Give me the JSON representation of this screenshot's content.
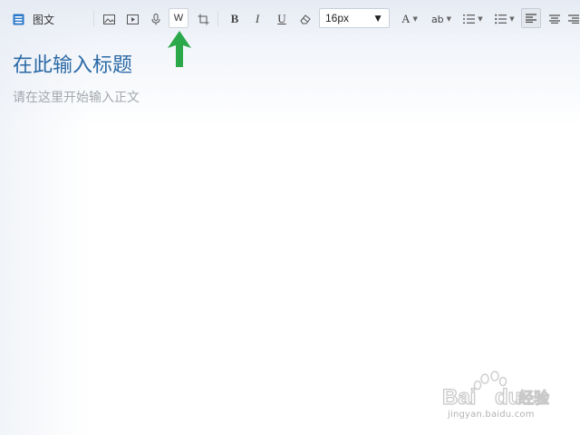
{
  "toolbar": {
    "brand_label": "图文",
    "word_label": "W",
    "bold_label": "B",
    "italic_label": "I",
    "underline_label": "U",
    "font_size": "16px",
    "font_color_label": "A",
    "highlight_label": "ab",
    "icons": [
      "article-icon",
      "image-icon",
      "video-icon",
      "microphone-icon",
      "crop-icon",
      "eraser-icon",
      "line-spacing-icon",
      "bullet-list-icon",
      "align-left-icon",
      "align-center-icon",
      "align-right-icon"
    ]
  },
  "editor": {
    "title_placeholder": "在此输入标题",
    "body_placeholder": "请在这里开始输入正文"
  },
  "watermark": {
    "logo": "Bai du 经验",
    "url": "jingyan.baidu.com"
  },
  "colors": {
    "title": "#2b6aa6",
    "body_placeholder": "#a3a8ae",
    "arrow": "#2aa84a",
    "brand_icon": "#2a78c8"
  }
}
